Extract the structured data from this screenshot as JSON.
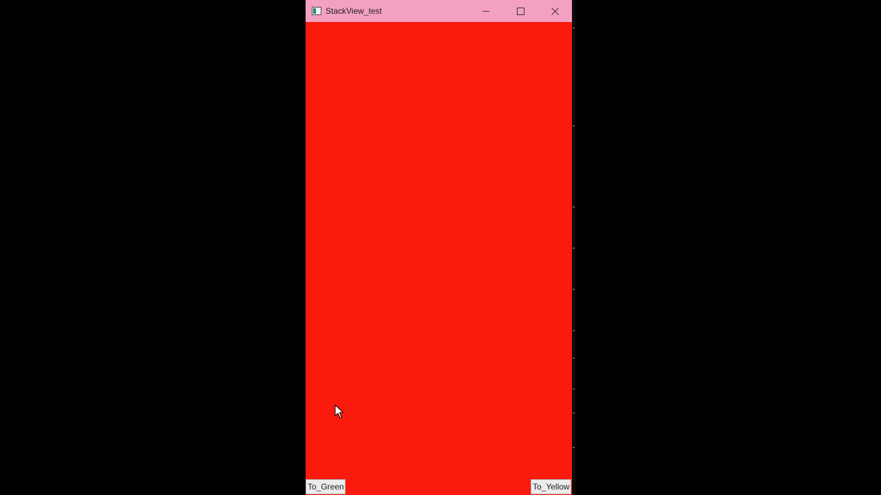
{
  "window": {
    "title": "StackView_test",
    "background_color": "#fa1a0e",
    "titlebar_color": "#f4a0c3",
    "app_icon": "app-window-icon",
    "controls": {
      "minimize_icon": "minimize-icon",
      "maximize_icon": "maximize-icon",
      "close_icon": "close-icon"
    }
  },
  "buttons": {
    "to_green": "To_Green",
    "to_yellow": "To_Yellow"
  },
  "cursor": {
    "icon": "mouse-pointer-icon"
  }
}
